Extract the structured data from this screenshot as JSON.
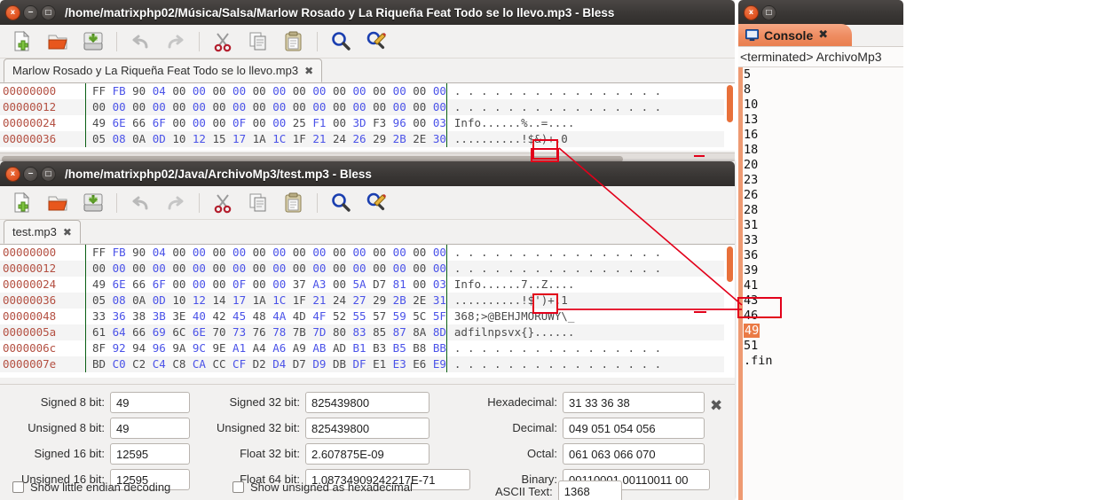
{
  "window_bless_1": {
    "title": "/home/matrixphp02/Música/Salsa/Marlow Rosado y La Riqueña Feat Todo se lo llevo.mp3 - Bless",
    "buttons": {
      "close": "x",
      "minimize": "−",
      "maximize": "□"
    },
    "toolbar": [
      {
        "name": "new-file-icon",
        "label": "New"
      },
      {
        "name": "open-file-icon",
        "label": "Open"
      },
      {
        "name": "save-file-icon",
        "label": "Save"
      },
      {
        "name": "undo-icon",
        "label": "Undo"
      },
      {
        "name": "redo-icon",
        "label": "Redo"
      },
      {
        "name": "cut-icon",
        "label": "Cut"
      },
      {
        "name": "copy-icon",
        "label": "Copy"
      },
      {
        "name": "paste-icon",
        "label": "Paste"
      },
      {
        "name": "find-icon",
        "label": "Find"
      },
      {
        "name": "find-replace-icon",
        "label": "Find and Replace"
      }
    ],
    "tab": {
      "label": "Marlow Rosado y La Riqueña Feat Todo se lo llevo.mp3",
      "close": "✖"
    },
    "hex_rows": [
      {
        "offset": "00000000",
        "bytes": [
          "FF",
          "FB",
          "90",
          "04",
          "00",
          "00",
          "00",
          "00",
          "00",
          "00",
          "00",
          "00",
          "00",
          "00",
          "00",
          "00",
          "00",
          "00"
        ],
        "ascii": ". . . . . . . . . . . . . . . ."
      },
      {
        "offset": "00000012",
        "bytes": [
          "00",
          "00",
          "00",
          "00",
          "00",
          "00",
          "00",
          "00",
          "00",
          "00",
          "00",
          "00",
          "00",
          "00",
          "00",
          "00",
          "00",
          "00"
        ],
        "ascii": ". . . . . . . . . . . . . . . ."
      },
      {
        "offset": "00000024",
        "bytes": [
          "49",
          "6E",
          "66",
          "6F",
          "00",
          "00",
          "00",
          "0F",
          "00",
          "00",
          "25",
          "F1",
          "00",
          "3D",
          "F3",
          "96",
          "00",
          "03"
        ],
        "ascii": "Info......%..=...."
      },
      {
        "offset": "00000036",
        "bytes": [
          "05",
          "08",
          "0A",
          "0D",
          "10",
          "12",
          "15",
          "17",
          "1A",
          "1C",
          "1F",
          "21",
          "24",
          "26",
          "29",
          "2B",
          "2E",
          "30"
        ],
        "ascii": "..........!$&)+.0"
      }
    ],
    "selected_byte": "30",
    "selected_ascii": "0"
  },
  "window_bless_2": {
    "title": "/home/matrixphp02/Java/ArchivoMp3/test.mp3 - Bless",
    "buttons": {
      "close": "x",
      "minimize": "−",
      "maximize": "□"
    },
    "tab": {
      "label": "test.mp3",
      "close": "✖"
    },
    "hex_rows": [
      {
        "offset": "00000000",
        "bytes": [
          "FF",
          "FB",
          "90",
          "04",
          "00",
          "00",
          "00",
          "00",
          "00",
          "00",
          "00",
          "00",
          "00",
          "00",
          "00",
          "00",
          "00",
          "00"
        ],
        "ascii": ". . . . . . . . . . . . . . . ."
      },
      {
        "offset": "00000012",
        "bytes": [
          "00",
          "00",
          "00",
          "00",
          "00",
          "00",
          "00",
          "00",
          "00",
          "00",
          "00",
          "00",
          "00",
          "00",
          "00",
          "00",
          "00",
          "00"
        ],
        "ascii": ". . . . . . . . . . . . . . . ."
      },
      {
        "offset": "00000024",
        "bytes": [
          "49",
          "6E",
          "66",
          "6F",
          "00",
          "00",
          "00",
          "0F",
          "00",
          "00",
          "37",
          "A3",
          "00",
          "5A",
          "D7",
          "81",
          "00",
          "03"
        ],
        "ascii": "Info......7..Z...."
      },
      {
        "offset": "00000036",
        "bytes": [
          "05",
          "08",
          "0A",
          "0D",
          "10",
          "12",
          "14",
          "17",
          "1A",
          "1C",
          "1F",
          "21",
          "24",
          "27",
          "29",
          "2B",
          "2E",
          "31"
        ],
        "ascii": "..........!$')+.1"
      },
      {
        "offset": "00000048",
        "bytes": [
          "33",
          "36",
          "38",
          "3B",
          "3E",
          "40",
          "42",
          "45",
          "48",
          "4A",
          "4D",
          "4F",
          "52",
          "55",
          "57",
          "59",
          "5C",
          "5F"
        ],
        "ascii": "368;>@BEHJMORUWY\\_"
      },
      {
        "offset": "0000005a",
        "bytes": [
          "61",
          "64",
          "66",
          "69",
          "6C",
          "6E",
          "70",
          "73",
          "76",
          "78",
          "7B",
          "7D",
          "80",
          "83",
          "85",
          "87",
          "8A",
          "8D"
        ],
        "ascii": "adfilnpsvx{}......"
      },
      {
        "offset": "0000006c",
        "bytes": [
          "8F",
          "92",
          "94",
          "96",
          "9A",
          "9C",
          "9E",
          "A1",
          "A4",
          "A6",
          "A9",
          "AB",
          "AD",
          "B1",
          "B3",
          "B5",
          "B8",
          "BB"
        ],
        "ascii": ". . . . . . . . . . . . . . . ."
      },
      {
        "offset": "0000007e",
        "bytes": [
          "BD",
          "C0",
          "C2",
          "C4",
          "C8",
          "CA",
          "CC",
          "CF",
          "D2",
          "D4",
          "D7",
          "D9",
          "DB",
          "DF",
          "E1",
          "E3",
          "E6",
          "E9"
        ],
        "ascii": ". . . . . . . . . . . . . . . ."
      }
    ],
    "selected_byte": "31",
    "selected_ascii": "1"
  },
  "decode_panel": {
    "fields": [
      {
        "label": "Signed 8 bit:",
        "value": "49"
      },
      {
        "label": "Unsigned 8 bit:",
        "value": "49"
      },
      {
        "label": "Signed 16 bit:",
        "value": "12595"
      },
      {
        "label": "Unsigned 16 bit:",
        "value": "12595"
      },
      {
        "label": "Signed 32 bit:",
        "value": "825439800"
      },
      {
        "label": "Unsigned 32 bit:",
        "value": "825439800"
      },
      {
        "label": "Float 32 bit:",
        "value": "2.607875E-09"
      },
      {
        "label": "Float 64 bit:",
        "value": "1.08734909242217E-71"
      },
      {
        "label": "Hexadecimal:",
        "value": "31 33 36 38"
      },
      {
        "label": "Decimal:",
        "value": "049 051 054 056"
      },
      {
        "label": "Octal:",
        "value": "061 063 066 070"
      },
      {
        "label": "Binary:",
        "value": "00110001 00110011 00"
      },
      {
        "label": "ASCII Text:",
        "value": "1368"
      }
    ],
    "close_icon": "✖",
    "checkboxes": [
      {
        "label": "Show little endian decoding",
        "checked": false
      },
      {
        "label": "Show unsigned as hexadecimal",
        "checked": false
      }
    ]
  },
  "console_window": {
    "buttons": {
      "close": "x",
      "maximize": "□"
    },
    "tab_label": "Console",
    "tab_close": "✖",
    "terminated_line": "<terminated> ArchivoMp3",
    "output_lines": [
      "5",
      "8",
      "10",
      "13",
      "16",
      "18",
      "20",
      "23",
      "26",
      "28",
      "31",
      "33",
      "36",
      "39",
      "41",
      "43",
      "46",
      "49",
      "51",
      ".fin"
    ],
    "highlighted_line": "49"
  },
  "annotation": {
    "color": "#e2001a",
    "description": "red arrow linking selected bytes 30 / 31 to console value 49"
  }
}
